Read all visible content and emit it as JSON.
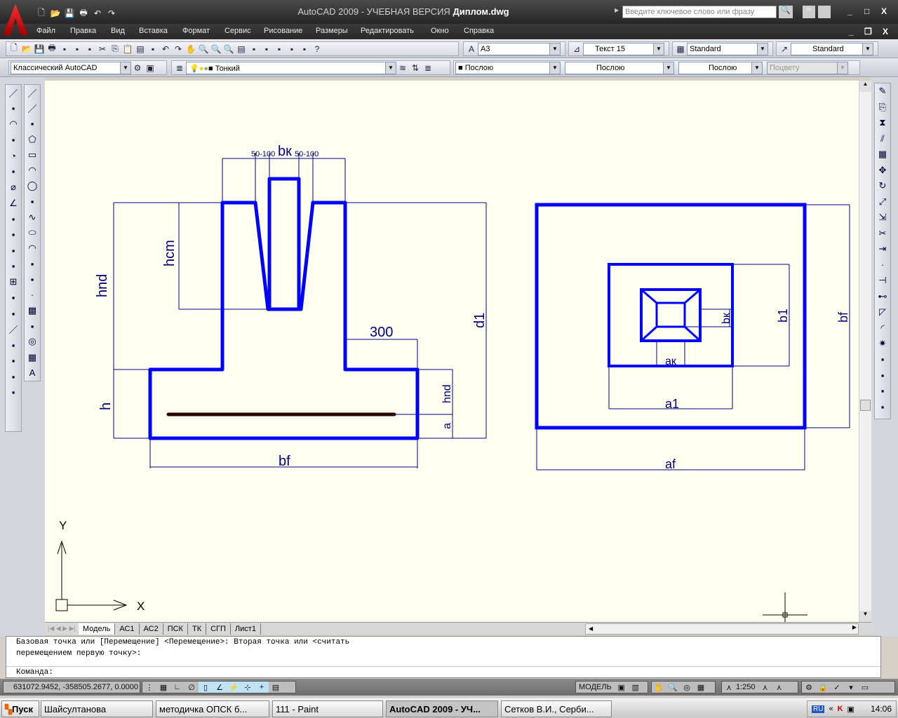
{
  "app": {
    "title_prefix": "AutoCAD 2009 - УЧЕБНАЯ ВЕРСИЯ",
    "file": "Диплом.dwg",
    "search_placeholder": "Введите ключевое слово или фразу",
    "brand_color": "#cc0000"
  },
  "quick_access": [
    "new-icon",
    "open-icon",
    "save-icon",
    "print-icon",
    "undo-icon",
    "redo-icon"
  ],
  "menu": [
    "Файл",
    "Правка",
    "Вид",
    "Вставка",
    "Формат",
    "Сервис",
    "Рисование",
    "Размеры",
    "Редактировать",
    "Окно",
    "Справка"
  ],
  "toolbar1": {
    "icons": [
      "new-icon",
      "open-icon",
      "save-icon",
      "print-icon",
      "preview-icon",
      "publish-icon",
      "3d-dwf-icon",
      "cut-icon",
      "copy-icon",
      "paste-icon",
      "match-properties-icon",
      "block-editor-icon",
      "undo-icon",
      "redo-icon",
      "pan-icon",
      "zoom-realtime-icon",
      "zoom-window-icon",
      "zoom-previous-icon",
      "properties-icon",
      "design-center-icon",
      "tool-palettes-icon",
      "sheet-set-icon",
      "markup-icon",
      "quickcalc-icon",
      "help-icon"
    ],
    "text_style": "A3",
    "dim_style": "Текст 15",
    "table_style": "Standard",
    "multileader_style": "Standard"
  },
  "toolbar2": {
    "workspace": "Классический AutoCAD",
    "layer": "Тонкий",
    "color": "Послою",
    "linetype": "Послою",
    "lineweight": "Послою",
    "plot_style": "Поцвету"
  },
  "draw_tools": [
    "line-icon",
    "construction-line-icon",
    "polyline-icon",
    "polygon-icon",
    "rectangle-icon",
    "arc-icon",
    "circle-icon",
    "revision-cloud-icon",
    "spline-icon",
    "ellipse-icon",
    "ellipse-arc-icon",
    "insert-block-icon",
    "make-block-icon",
    "point-icon",
    "hatch-icon",
    "gradient-icon",
    "region-icon",
    "table-icon",
    "mtext-icon"
  ],
  "dim_tools": [
    "linear-dim-icon",
    "aligned-dim-icon",
    "arc-length-icon",
    "ordinate-icon",
    "radius-icon",
    "jogged-icon",
    "diameter-icon",
    "angular-icon",
    "quick-dim-icon",
    "baseline-icon",
    "continue-icon",
    "qleader-icon",
    "tolerance-icon",
    "center-mark-icon",
    "inspection-icon",
    "jogged-linear-icon",
    "dim-edit-icon",
    "dim-text-edit-icon",
    "dim-update-icon",
    "dim-style-icon"
  ],
  "modify_tools": [
    "erase-icon",
    "copy-icon",
    "mirror-icon",
    "offset-icon",
    "array-icon",
    "move-icon",
    "rotate-icon",
    "scale-icon",
    "stretch-icon",
    "trim-icon",
    "extend-icon",
    "break-at-point-icon",
    "break-icon",
    "join-icon",
    "chamfer-icon",
    "fillet-icon",
    "explode-icon",
    "draworder-front-icon",
    "draworder-back-icon",
    "draworder-above-icon",
    "draworder-under-icon"
  ],
  "drawing": {
    "section_labels": {
      "bk": "bк",
      "gap_left": "50-100",
      "gap_right": "50-100",
      "hcm": "hcm",
      "hnd": "hnd",
      "h": "h",
      "step": "300",
      "d1": "d1",
      "hnd_small": "hnd",
      "a": "a",
      "bf": "bf"
    },
    "plan_labels": {
      "bk": "bк",
      "b1": "b1",
      "bf": "bf",
      "ak": "aк",
      "a1": "a1",
      "af": "af"
    },
    "ucs": {
      "x": "X",
      "y": "Y"
    },
    "colors": {
      "outline": "#0000ff",
      "dimension": "#000080",
      "rebar": "#2a0000",
      "background": "#fffff0"
    }
  },
  "layout_tabs": [
    "Модель",
    "АС1",
    "АС2",
    "ПСК",
    "ТК",
    "СГП",
    "Лист1"
  ],
  "command": {
    "history": [
      "Базовая точка или [Перемещение] <Перемещение>: Вторая точка или <считать",
      "перемещением первую точку>:"
    ],
    "prompt": "Команда:"
  },
  "status": {
    "coords": "631072.9452, -358505.2677, 0.0000",
    "model": "МОДЕЛЬ",
    "scale": "1:250"
  },
  "taskbar": {
    "start": "Пуск",
    "tasks": [
      "Шайсултанова",
      "методичка ОПСК б...",
      "111 - Paint",
      "AutoCAD 2009 - УЧ...",
      "Сетков В.И., Серби..."
    ],
    "lang": "RU",
    "clock": "14:06"
  }
}
